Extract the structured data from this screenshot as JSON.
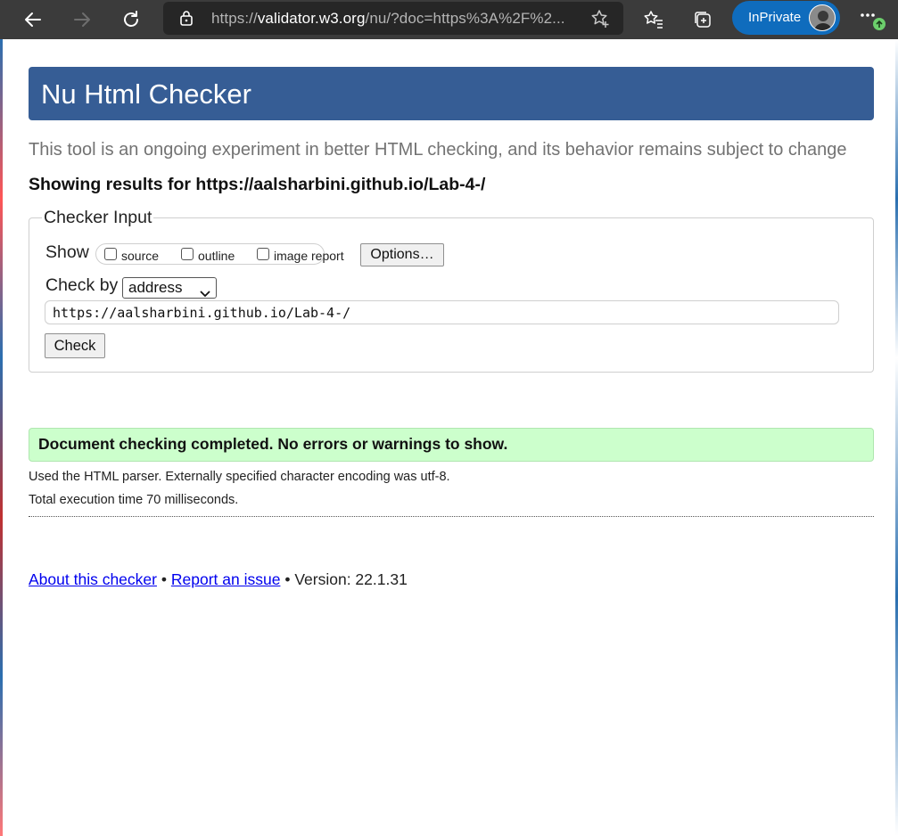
{
  "browser": {
    "url_prefix": "https://",
    "url_host": "validator.w3.org",
    "url_rest": "/nu/?doc=https%3A%2F%2...",
    "inprivate_label": "InPrivate",
    "accent": "#0f6cbd"
  },
  "page": {
    "title": "Nu Html Checker",
    "tagline": "This tool is an ongoing experiment in better HTML checking, and its behavior remains subject to change",
    "results_for": "Showing results for https://aalsharbini.github.io/Lab-4-/",
    "banner_color": "#365d95"
  },
  "checker_input": {
    "legend": "Checker Input",
    "show_label": "Show",
    "options": [
      {
        "label": "source",
        "checked": false
      },
      {
        "label": "outline",
        "checked": false
      },
      {
        "label": "image report",
        "checked": false
      }
    ],
    "options_button": "Options…",
    "check_by_label": "Check by",
    "check_by_value": "address",
    "url_value": "https://aalsharbini.github.io/Lab-4-/",
    "check_button": "Check"
  },
  "results": {
    "success_message": "Document checking completed. No errors or warnings to show.",
    "success_color": "#ccffcc",
    "parser_info": "Used the HTML parser. Externally specified character encoding was utf-8.",
    "execution_time": "Total execution time 70 milliseconds."
  },
  "footer": {
    "about_link": "About this checker",
    "sep": "•",
    "report_link": "Report an issue",
    "version": "Version: 22.1.31"
  }
}
